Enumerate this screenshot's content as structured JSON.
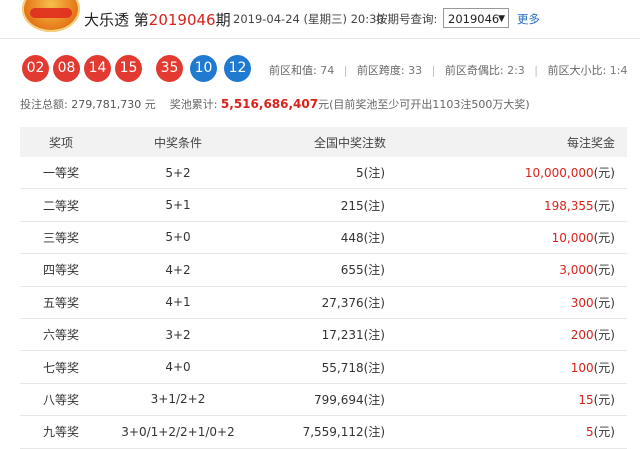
{
  "header": {
    "logo_icon": "lottery-logo-icon",
    "title_prefix": "大乐透 第",
    "issue_number": "2019046",
    "title_suffix": "期",
    "draw_datetime": "2019-04-24 (星期三) 20:30",
    "query_label": "按期号查询:",
    "select_value": "2019046",
    "more_label": "更多"
  },
  "balls": {
    "front": [
      "02",
      "08",
      "14",
      "15",
      "35"
    ],
    "back": [
      "10",
      "12"
    ],
    "colors": {
      "front": "#e23a30",
      "back": "#1f7ad0"
    }
  },
  "stats": {
    "sum_label": "前区和值:",
    "sum_value": "74",
    "span_label": "前区跨度:",
    "span_value": "33",
    "odd_even_label": "前区奇偶比:",
    "odd_even_value": "2:3",
    "big_small_label": "前区大小比:",
    "big_small_value": "1:4"
  },
  "sales": {
    "total_label": "投注总额:",
    "total_value": "279,781,730",
    "total_unit": "元",
    "pool_label": "奖池累计:",
    "pool_value": "5,516,686,407",
    "pool_note": "元(目前奖池至少可开出1103注500万大奖)"
  },
  "table": {
    "headers": [
      "奖项",
      "中奖条件",
      "全国中奖注数",
      "每注奖金"
    ],
    "rows": [
      {
        "level": "一等奖",
        "condition": "5+2",
        "count": "5(注)",
        "amount": "10,000,000",
        "unit": "(元)"
      },
      {
        "level": "二等奖",
        "condition": "5+1",
        "count": "215(注)",
        "amount": "198,355",
        "unit": "(元)"
      },
      {
        "level": "三等奖",
        "condition": "5+0",
        "count": "448(注)",
        "amount": "10,000",
        "unit": "(元)"
      },
      {
        "level": "四等奖",
        "condition": "4+2",
        "count": "655(注)",
        "amount": "3,000",
        "unit": "(元)"
      },
      {
        "level": "五等奖",
        "condition": "4+1",
        "count": "27,376(注)",
        "amount": "300",
        "unit": "(元)"
      },
      {
        "level": "六等奖",
        "condition": "3+2",
        "count": "17,231(注)",
        "amount": "200",
        "unit": "(元)"
      },
      {
        "level": "七等奖",
        "condition": "4+0",
        "count": "55,718(注)",
        "amount": "100",
        "unit": "(元)"
      },
      {
        "level": "八等奖",
        "condition": "3+1/2+2",
        "count": "799,694(注)",
        "amount": "15",
        "unit": "(元)"
      },
      {
        "level": "九等奖",
        "condition": "3+0/1+2/2+1/0+2",
        "count": "7,559,112(注)",
        "amount": "5",
        "unit": "(元)"
      }
    ]
  }
}
